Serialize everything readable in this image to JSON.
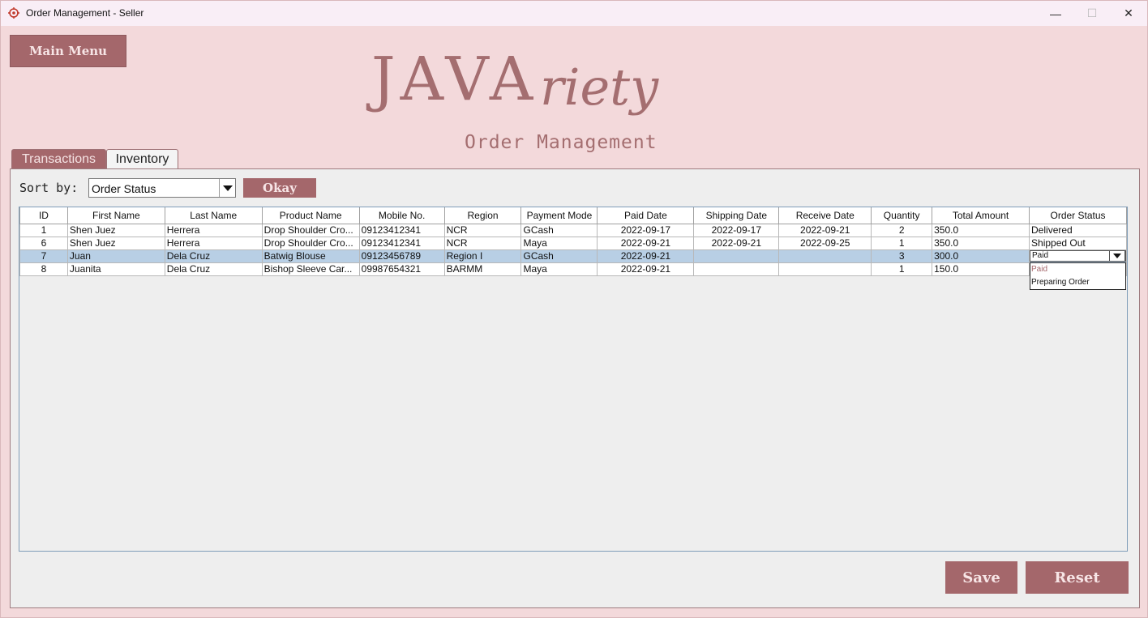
{
  "window": {
    "title": "Order Management - Seller",
    "controls": {
      "minimize": "—",
      "maximize": "☐",
      "close": "✕"
    }
  },
  "header": {
    "main_menu_label": "Main Menu",
    "logo_block": "JAVA",
    "logo_script": "riety",
    "subtitle": "Order Management"
  },
  "tabs": [
    {
      "label": "Transactions",
      "active": true
    },
    {
      "label": "Inventory",
      "active": false
    }
  ],
  "sort": {
    "label": "Sort by:",
    "selected": "Order Status",
    "okay_label": "Okay"
  },
  "table": {
    "columns": [
      "ID",
      "First Name",
      "Last Name",
      "Product Name",
      "Mobile No.",
      "Region",
      "Payment Mode",
      "Paid Date",
      "Shipping Date",
      "Receive Date",
      "Quantity",
      "Total Amount",
      "Order Status"
    ],
    "rows": [
      {
        "id": "1",
        "first": "Shen Juez",
        "last": "Herrera",
        "product": "Drop Shoulder Cro...",
        "mobile": "09123412341",
        "region": "NCR",
        "payment": "GCash",
        "paid": "2022-09-17",
        "shipping": "2022-09-17",
        "receive": "2022-09-21",
        "qty": "2",
        "total": "350.0",
        "status": "Delivered"
      },
      {
        "id": "6",
        "first": "Shen Juez",
        "last": "Herrera",
        "product": "Drop Shoulder Cro...",
        "mobile": "09123412341",
        "region": "NCR",
        "payment": "Maya",
        "paid": "2022-09-21",
        "shipping": "2022-09-21",
        "receive": "2022-09-25",
        "qty": "1",
        "total": "350.0",
        "status": "Shipped Out"
      },
      {
        "id": "7",
        "first": "Juan",
        "last": "Dela Cruz",
        "product": "Batwig Blouse",
        "mobile": "09123456789",
        "region": "Region I",
        "payment": "GCash",
        "paid": "2022-09-21",
        "shipping": "",
        "receive": "",
        "qty": "3",
        "total": "300.0",
        "status": "Paid"
      },
      {
        "id": "8",
        "first": "Juanita",
        "last": "Dela Cruz",
        "product": "Bishop Sleeve Car...",
        "mobile": "09987654321",
        "region": "BARMM",
        "payment": "Maya",
        "paid": "2022-09-21",
        "shipping": "",
        "receive": "",
        "qty": "1",
        "total": "150.0",
        "status": ""
      }
    ]
  },
  "status_dropdown": {
    "options": [
      "Paid",
      "Preparing Order"
    ]
  },
  "actions": {
    "save_label": "Save",
    "reset_label": "Reset"
  },
  "colors": {
    "accent": "#a4676b",
    "background": "#f3d9db",
    "selection": "#b8cfe5"
  }
}
